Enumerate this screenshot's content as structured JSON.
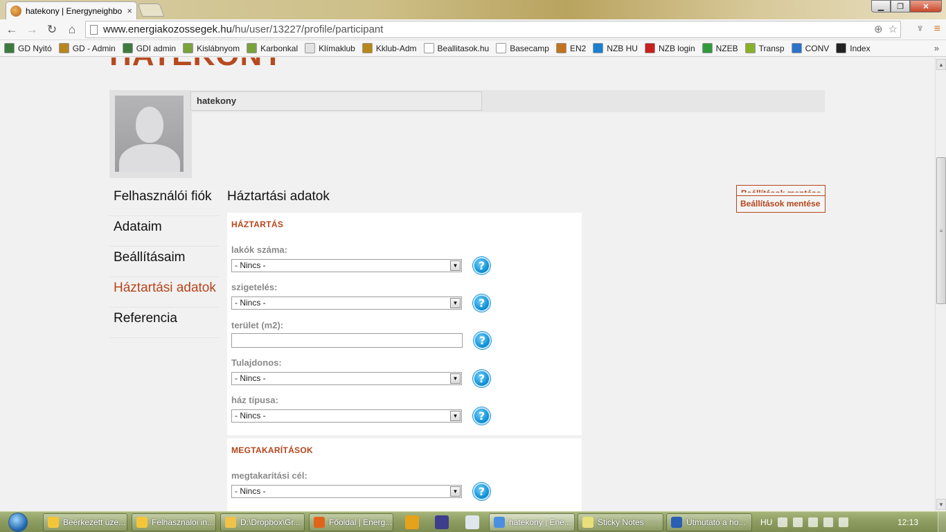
{
  "browser": {
    "tab_title": "hatekony | Energyneighbo",
    "tab_close": "×",
    "url_domain": "www.energiakozossegek.hu",
    "url_path": "/hu/user/13227/profile/participant"
  },
  "bookmarks": [
    {
      "label": "GD Nyitó",
      "color": "#3d7a3d"
    },
    {
      "label": "GD - Admin",
      "color": "#b8861b"
    },
    {
      "label": "GDI admin",
      "color": "#3d7a3d"
    },
    {
      "label": "Kislábnyom",
      "color": "#78a33a"
    },
    {
      "label": "Karbonkal",
      "color": "#78a33a"
    },
    {
      "label": "Klímaklub",
      "color": "#e2e2e2"
    },
    {
      "label": "Kklub-Adm",
      "color": "#b8861b"
    },
    {
      "label": "Beallitasok.hu",
      "color": "#ffffff"
    },
    {
      "label": "Basecamp",
      "color": "#ffffff"
    },
    {
      "label": "EN2",
      "color": "#c2741f"
    },
    {
      "label": "NZB HU",
      "color": "#1a7fd0"
    },
    {
      "label": "NZB login",
      "color": "#c8201b"
    },
    {
      "label": "NZEB",
      "color": "#2e9a3b"
    },
    {
      "label": "Transp",
      "color": "#88b12a"
    },
    {
      "label": "CONV",
      "color": "#2a74c9"
    },
    {
      "label": "Index",
      "color": "#222222"
    }
  ],
  "site": {
    "title": "HATÉKONY"
  },
  "profile": {
    "username": "hatekony"
  },
  "sidebar": {
    "items": [
      {
        "label": "Felhasználói fiók"
      },
      {
        "label": "Adataim"
      },
      {
        "label": "Beállításaim"
      },
      {
        "label": "Háztartási adatok",
        "active": true
      },
      {
        "label": "Referencia"
      }
    ]
  },
  "main": {
    "heading": "Háztartási adatok",
    "save_label": "Beállítások mentése",
    "save_label_ghost": "Beállítások mentése",
    "sections": {
      "household": {
        "title": "HÁZTARTÁS",
        "fields": [
          {
            "label": "lakók száma:",
            "type": "select",
            "value": "- Nincs -"
          },
          {
            "label": "szigetelés:",
            "type": "select",
            "value": "- Nincs -"
          },
          {
            "label": "terület (m2):",
            "type": "text",
            "value": ""
          },
          {
            "label": "Tulajdonos:",
            "type": "select",
            "value": "- Nincs -"
          },
          {
            "label": "ház típusa:",
            "type": "select",
            "value": "- Nincs -"
          }
        ]
      },
      "savings": {
        "title": "MEGTAKARÍTÁSOK",
        "fields": [
          {
            "label": "megtakarítási cél:",
            "type": "select",
            "value": "- Nincs -"
          }
        ]
      }
    },
    "help_glyph": "?",
    "select_arrow": "▼"
  },
  "taskbar": {
    "buttons": [
      {
        "label": "Beérkezett üze...",
        "color": "#f3c63a"
      },
      {
        "label": "Felhasznaloi in...",
        "color": "#f3c63a"
      },
      {
        "label": "D:\\Dropbox\\Gr...",
        "color": "#f0c24a"
      },
      {
        "label": "Főoldal | Energ...",
        "color": "#e0651b"
      },
      {
        "label": "hatekony | Ene...",
        "color": "#4a8fe0",
        "active": true
      },
      {
        "label": "Sticky Notes",
        "color": "#e8e07a"
      },
      {
        "label": "Útmutató a ho...",
        "color": "#2b5fb3"
      }
    ],
    "language": "HU",
    "time": "12:13"
  }
}
